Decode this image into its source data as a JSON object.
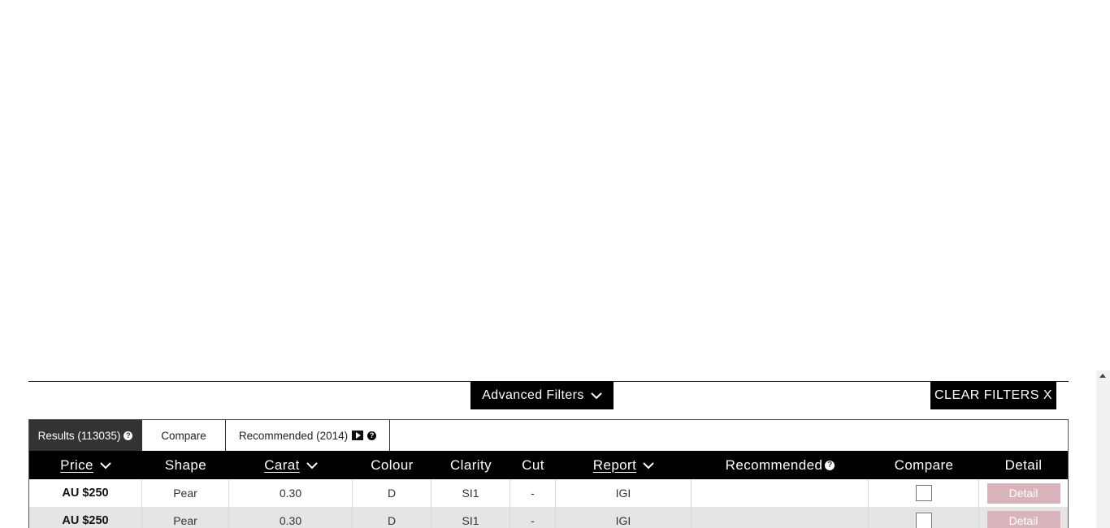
{
  "filters": {
    "advanced_label": "Advanced Filters",
    "clear_label": "CLEAR FILTERS X"
  },
  "tabs": [
    {
      "label": "Results (113035)",
      "active": true
    },
    {
      "label": "Compare",
      "active": false
    },
    {
      "label": "Recommended (2014)",
      "active": false
    }
  ],
  "table": {
    "headers": {
      "price": "Price",
      "shape": "Shape",
      "carat": "Carat",
      "colour": "Colour",
      "clarity": "Clarity",
      "cut": "Cut",
      "report": "Report",
      "recommended": "Recommended",
      "compare": "Compare",
      "detail": "Detail"
    },
    "rows": [
      {
        "price": "AU $250",
        "shape": "Pear",
        "carat": "0.30",
        "colour": "D",
        "clarity": "SI1",
        "cut": "-",
        "report": "IGI",
        "detail_label": "Detail"
      },
      {
        "price": "AU $250",
        "shape": "Pear",
        "carat": "0.30",
        "colour": "D",
        "clarity": "SI1",
        "cut": "-",
        "report": "IGI",
        "detail_label": "Detail"
      }
    ]
  },
  "colors": {
    "header_bg": "#000000",
    "active_tab_bg": "#333333",
    "detail_button": "#d9b4bd",
    "alt_row_bg": "#e5e5e5"
  }
}
